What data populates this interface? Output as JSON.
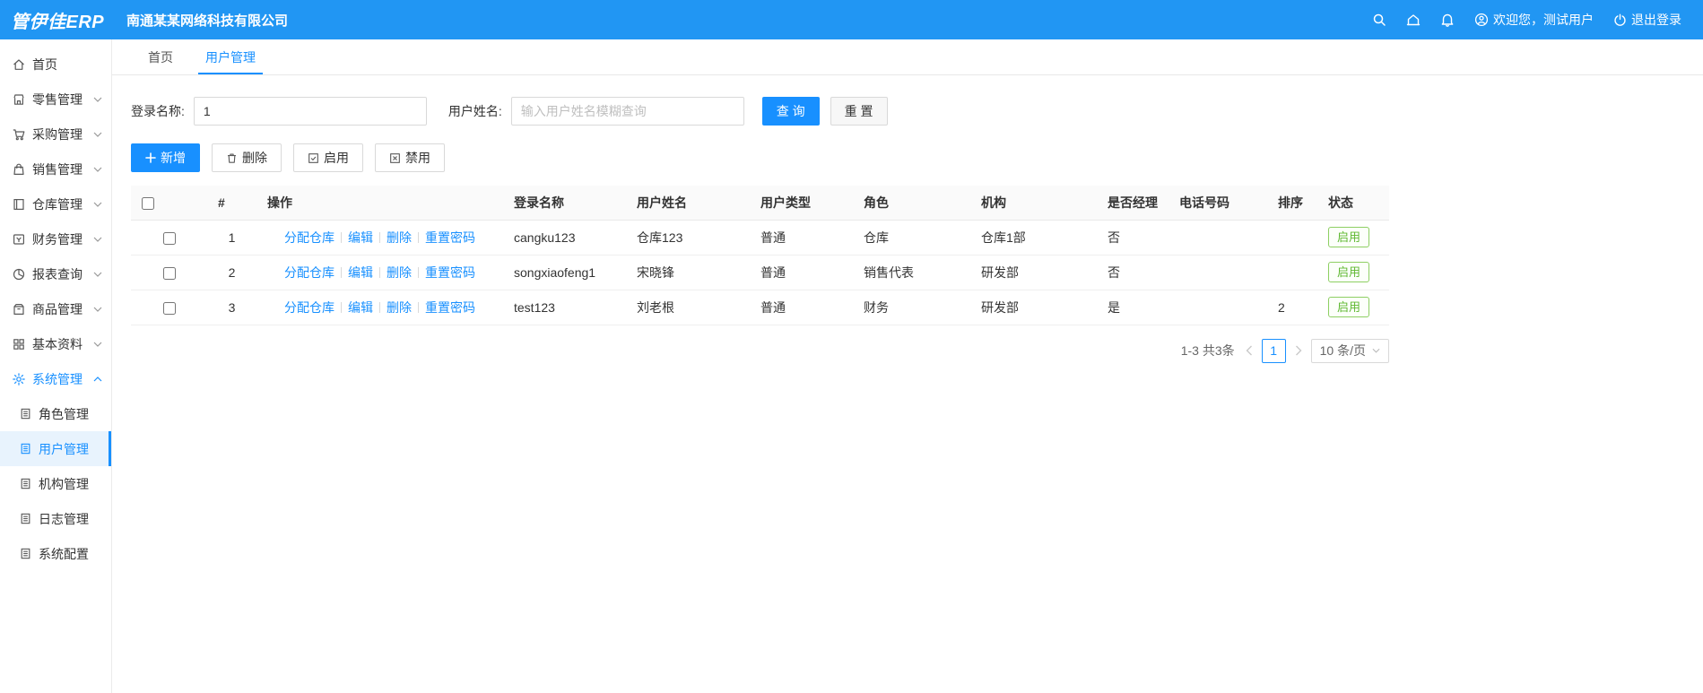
{
  "colors": {
    "primary": "#1890ff",
    "header_bg": "#2196f3",
    "success_border": "#8ecf63",
    "success_text": "#5fb832"
  },
  "header": {
    "logo": "管伊佳ERP",
    "company": "南通某某网络科技有限公司",
    "welcome": "欢迎您，测试用户",
    "logout": "退出登录"
  },
  "sidebar": {
    "items": [
      {
        "label": "首页"
      },
      {
        "label": "零售管理"
      },
      {
        "label": "采购管理"
      },
      {
        "label": "销售管理"
      },
      {
        "label": "仓库管理"
      },
      {
        "label": "财务管理"
      },
      {
        "label": "报表查询"
      },
      {
        "label": "商品管理"
      },
      {
        "label": "基本资料"
      },
      {
        "label": "系统管理"
      }
    ],
    "sub_items": [
      {
        "label": "角色管理"
      },
      {
        "label": "用户管理"
      },
      {
        "label": "机构管理"
      },
      {
        "label": "日志管理"
      },
      {
        "label": "系统配置"
      }
    ]
  },
  "tabs": {
    "items": [
      {
        "label": "首页"
      },
      {
        "label": "用户管理"
      }
    ]
  },
  "search": {
    "login_label": "登录名称:",
    "login_value": "1",
    "name_label": "用户姓名:",
    "name_placeholder": "输入用户姓名模糊查询",
    "query_button": "查 询",
    "reset_button": "重 置"
  },
  "toolbar": {
    "add": "新增",
    "delete": "删除",
    "enable": "启用",
    "disable": "禁用"
  },
  "table": {
    "headers": [
      "#",
      "操作",
      "登录名称",
      "用户姓名",
      "用户类型",
      "角色",
      "机构",
      "是否经理",
      "电话号码",
      "排序",
      "状态"
    ],
    "op_links": [
      "分配仓库",
      "编辑",
      "删除",
      "重置密码"
    ],
    "rows": [
      {
        "index": "1",
        "login": "cangku123",
        "name": "仓库123",
        "type": "普通",
        "role": "仓库",
        "org": "仓库1部",
        "manager": "否",
        "phone": "",
        "sort": "",
        "status": "启用"
      },
      {
        "index": "2",
        "login": "songxiaofeng1",
        "name": "宋晓锋",
        "type": "普通",
        "role": "销售代表",
        "org": "研发部",
        "manager": "否",
        "phone": "",
        "sort": "",
        "status": "启用"
      },
      {
        "index": "3",
        "login": "test123",
        "name": "刘老根",
        "type": "普通",
        "role": "财务",
        "org": "研发部",
        "manager": "是",
        "phone": "",
        "sort": "2",
        "status": "启用"
      }
    ]
  },
  "pagination": {
    "total": "1-3 共3条",
    "current_page": "1",
    "page_size": "10 条/页"
  }
}
